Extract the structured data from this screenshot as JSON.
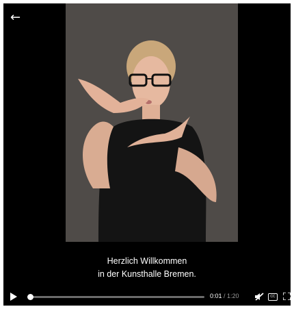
{
  "player": {
    "back_icon": "arrow-left-icon",
    "subtitle_line1": "Herzlich Willkommen",
    "subtitle_line2": "in der Kunsthalle Bremen.",
    "progress_fraction": 0.0125,
    "time_current": "0:01",
    "time_separator": " / ",
    "time_duration": "1:20",
    "icons": {
      "play": "play-icon",
      "mute": "muted-speaker-icon",
      "captions": "closed-captions-icon",
      "fullscreen": "fullscreen-icon"
    },
    "captions_label": "CC"
  },
  "colors": {
    "background": "#000000",
    "video_backdrop": "#4f4b48",
    "track": "#6b6b6b",
    "text": "#ffffff"
  }
}
